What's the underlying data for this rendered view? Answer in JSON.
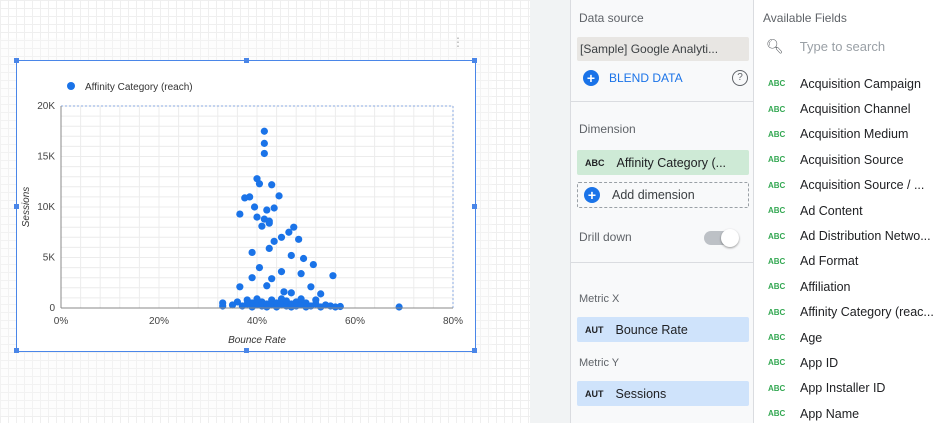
{
  "chart": {
    "legend_label": "Affinity Category (reach)",
    "x_axis_title": "Bounce Rate",
    "y_axis_title": "Sessions",
    "x_ticks": [
      "0%",
      "20%",
      "40%",
      "60%",
      "80%"
    ],
    "y_ticks": [
      "0",
      "5K",
      "10K",
      "15K",
      "20K"
    ],
    "series_color": "#1a73e8"
  },
  "chart_data": {
    "type": "scatter",
    "series": [
      {
        "name": "Affinity Category (reach)",
        "points": [
          [
            41.5,
            17500
          ],
          [
            41.5,
            16300
          ],
          [
            41.5,
            15300
          ],
          [
            40,
            12800
          ],
          [
            40.5,
            12300
          ],
          [
            43,
            12200
          ],
          [
            38.5,
            11000
          ],
          [
            37.5,
            10900
          ],
          [
            44.5,
            11100
          ],
          [
            39.5,
            10000
          ],
          [
            42,
            9700
          ],
          [
            43.5,
            9900
          ],
          [
            36.5,
            9300
          ],
          [
            40,
            9000
          ],
          [
            41.5,
            8800
          ],
          [
            42.5,
            8600
          ],
          [
            41,
            8100
          ],
          [
            42.5,
            8400
          ],
          [
            47.5,
            8000
          ],
          [
            46.5,
            7500
          ],
          [
            45,
            7000
          ],
          [
            48.5,
            6800
          ],
          [
            43.5,
            6600
          ],
          [
            42.5,
            5900
          ],
          [
            39,
            5500
          ],
          [
            47,
            5200
          ],
          [
            49.5,
            4900
          ],
          [
            51.5,
            4300
          ],
          [
            55.5,
            3200
          ],
          [
            40.5,
            4000
          ],
          [
            45,
            3600
          ],
          [
            49,
            3400
          ],
          [
            39,
            3000
          ],
          [
            43,
            2900
          ],
          [
            36.5,
            2100
          ],
          [
            42,
            2200
          ],
          [
            51,
            2100
          ],
          [
            45.5,
            1600
          ],
          [
            47,
            1500
          ],
          [
            53,
            1400
          ],
          [
            33,
            500
          ],
          [
            33,
            200
          ],
          [
            35,
            300
          ],
          [
            36,
            600
          ],
          [
            37,
            200
          ],
          [
            38,
            800
          ],
          [
            38,
            400
          ],
          [
            39,
            500
          ],
          [
            39,
            100
          ],
          [
            40,
            300
          ],
          [
            40,
            900
          ],
          [
            41,
            200
          ],
          [
            41,
            600
          ],
          [
            42,
            100
          ],
          [
            42,
            400
          ],
          [
            43,
            800
          ],
          [
            43,
            300
          ],
          [
            44,
            500
          ],
          [
            44,
            100
          ],
          [
            45,
            900
          ],
          [
            45,
            300
          ],
          [
            46,
            200
          ],
          [
            46,
            700
          ],
          [
            47,
            400
          ],
          [
            47,
            100
          ],
          [
            48,
            600
          ],
          [
            48,
            200
          ],
          [
            49,
            300
          ],
          [
            49,
            900
          ],
          [
            50,
            100
          ],
          [
            50,
            500
          ],
          [
            51,
            200
          ],
          [
            52,
            400
          ],
          [
            52,
            800
          ],
          [
            53,
            100
          ],
          [
            54,
            300
          ],
          [
            55,
            200
          ],
          [
            56,
            100
          ],
          [
            57,
            150
          ],
          [
            69,
            100
          ]
        ]
      }
    ],
    "xlabel": "Bounce Rate",
    "ylabel": "Sessions",
    "xlim": [
      0,
      80
    ],
    "ylim": [
      0,
      20000
    ],
    "grid": true,
    "legend_position": "top-left"
  },
  "data_panel": {
    "data_source_label": "Data source",
    "data_source_value": "[Sample] Google Analyti...",
    "blend_label": "BLEND DATA",
    "help_glyph": "?",
    "dimension_label": "Dimension",
    "dimension_chip_type": "ABC",
    "dimension_chip_label": "Affinity Category (...",
    "add_dimension_label": "Add dimension",
    "drill_down_label": "Drill down",
    "metric_x_label": "Metric X",
    "metric_x_chip_type": "AUT",
    "metric_x_chip_label": "Bounce Rate",
    "metric_y_label": "Metric Y",
    "metric_y_chip_type": "AUT",
    "metric_y_chip_label": "Sessions"
  },
  "fields_panel": {
    "title": "Available Fields",
    "search_placeholder": "Type to search",
    "type_badge": "ABC",
    "fields": [
      "Acquisition Campaign",
      "Acquisition Channel",
      "Acquisition Medium",
      "Acquisition Source",
      "Acquisition Source / ...",
      "Ad Content",
      "Ad Distribution Netwo...",
      "Ad Format",
      "Affiliation",
      "Affinity Category (reac...",
      "Age",
      "App ID",
      "App Installer ID",
      "App Name"
    ]
  },
  "icons": {
    "search": "search-icon",
    "add": "plus-circle-icon",
    "help": "help-icon",
    "kebab": "more-vert-icon"
  }
}
